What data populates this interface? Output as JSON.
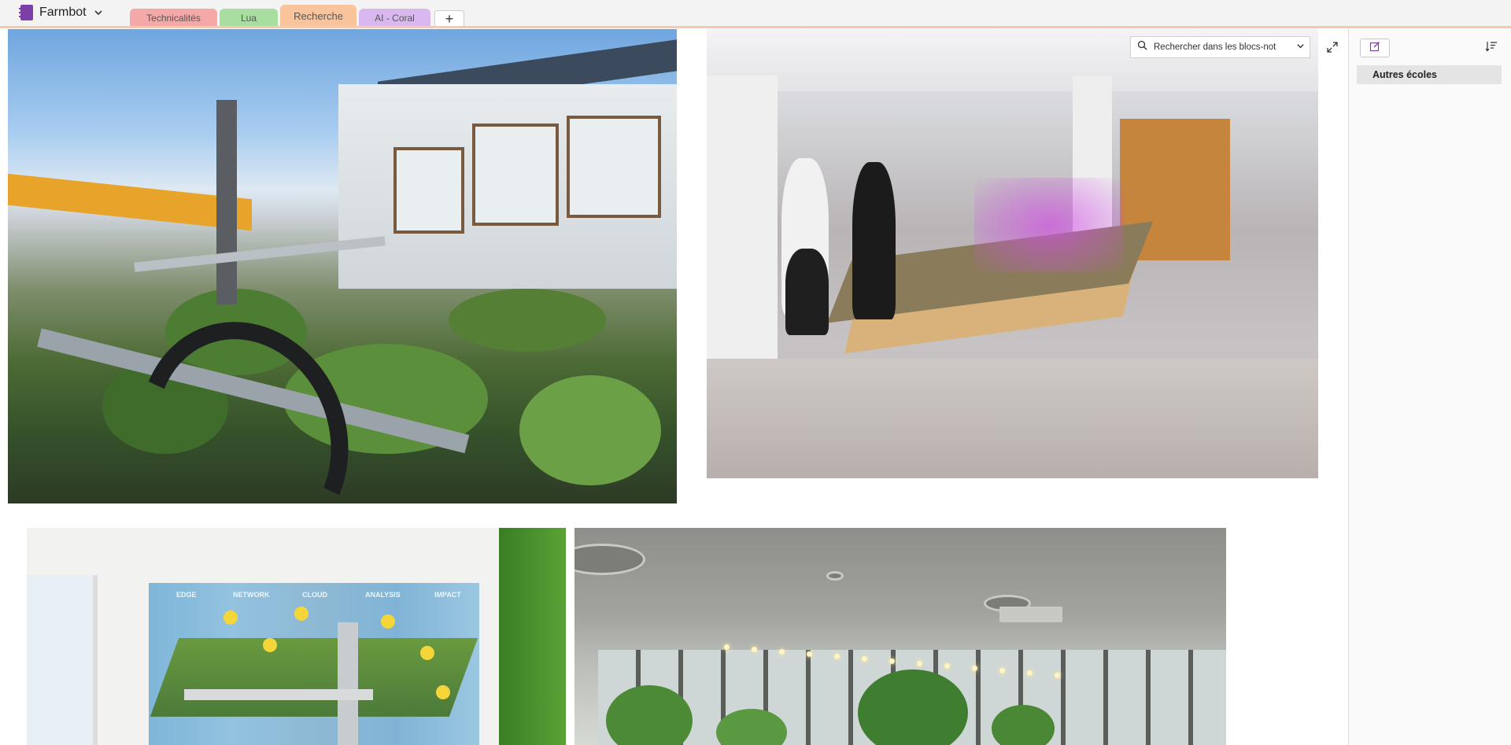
{
  "notebook": {
    "title": "Farmbot",
    "color": "#7b3fa6"
  },
  "tabs": [
    {
      "label": "Technicalités",
      "color": "#f4a9a8",
      "active": false
    },
    {
      "label": "Lua",
      "color": "#a8dfa0",
      "active": false
    },
    {
      "label": "Recherche",
      "color": "#f9c49b",
      "active": true
    },
    {
      "label": "AI - Coral",
      "color": "#d9b8ef",
      "active": false
    }
  ],
  "add_tab_label": "+",
  "search": {
    "placeholder": "Rechercher dans les blocs-not"
  },
  "pages": [
    {
      "label": "Autres écoles",
      "selected": true
    }
  ],
  "photo_labels": [
    "EDGE",
    "NETWORK",
    "CLOUD",
    "ANALYSIS",
    "IMPACT"
  ],
  "icons": {
    "notebook": "notebook-icon",
    "dropdown": "chevron-down-icon",
    "search": "search-icon",
    "search_dropdown": "chevron-down-icon",
    "expand": "expand-icon",
    "new_page": "new-page-icon",
    "sort": "sort-icon"
  }
}
